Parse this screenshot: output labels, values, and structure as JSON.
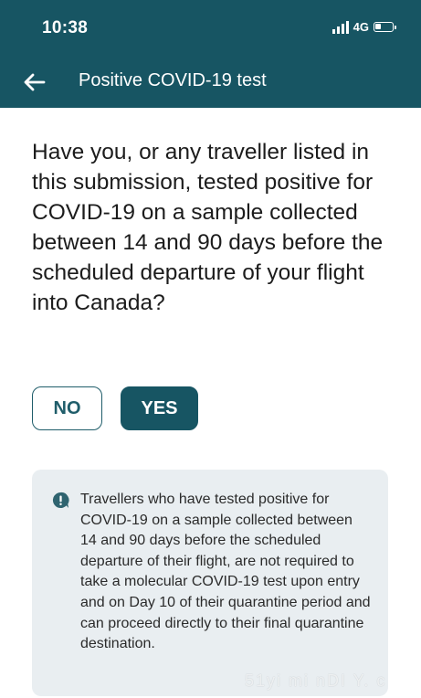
{
  "status_bar": {
    "time": "10:38",
    "network": "4G",
    "icons": [
      "signal-icon",
      "battery-icon"
    ]
  },
  "app_bar": {
    "back_icon": "back-arrow-icon",
    "title": "Positive COVID-19 test"
  },
  "question": "Have you, or any traveller listed in this submission, tested positive for COVID-19 on a sample collected between 14 and 90 days before the scheduled departure of your flight into Canada?",
  "answers": {
    "no_label": "NO",
    "yes_label": "YES",
    "selected": "YES"
  },
  "info": {
    "icon": "alert-bubble-icon",
    "text": "Travellers who have tested positive for COVID-19 on a sample collected between 14 and 90 days before the scheduled departure of their flight, are not required to take a molecular COVID-19 test upon entry and on Day 10 of their quarantine period and can proceed directly to their final quarantine destination."
  },
  "watermark": "51yi mi nDI Y. c",
  "colors": {
    "brand": "#175563",
    "info_background": "#e9eef1",
    "text": "#1c1c1c"
  }
}
